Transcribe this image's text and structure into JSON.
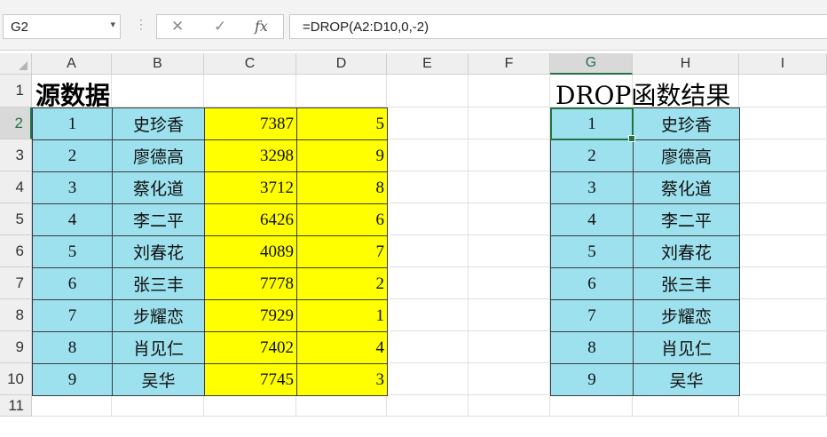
{
  "formula_bar": {
    "name_box": "G2",
    "formula": "=DROP(A2:D10,0,-2)",
    "cancel_icon": "✕",
    "enter_icon": "✓",
    "fx_label": "fx"
  },
  "columns": [
    "A",
    "B",
    "C",
    "D",
    "E",
    "F",
    "G",
    "H",
    "I"
  ],
  "rows": [
    "1",
    "2",
    "3",
    "4",
    "5",
    "6",
    "7",
    "8",
    "9",
    "10",
    "11"
  ],
  "selected_cell": "G2",
  "source_title": "源数据",
  "result_title": "DROP函数结果",
  "source_data": [
    [
      "1",
      "史珍香",
      "7387",
      "5"
    ],
    [
      "2",
      "廖德高",
      "3298",
      "9"
    ],
    [
      "3",
      "蔡化道",
      "3712",
      "8"
    ],
    [
      "4",
      "李二平",
      "6426",
      "6"
    ],
    [
      "5",
      "刘春花",
      "4089",
      "7"
    ],
    [
      "6",
      "张三丰",
      "7778",
      "2"
    ],
    [
      "7",
      "步耀恋",
      "7929",
      "1"
    ],
    [
      "8",
      "肖见仁",
      "7402",
      "4"
    ],
    [
      "9",
      "吴华",
      "7745",
      "3"
    ]
  ],
  "result_data": [
    [
      "1",
      "史珍香"
    ],
    [
      "2",
      "廖德高"
    ],
    [
      "3",
      "蔡化道"
    ],
    [
      "4",
      "李二平"
    ],
    [
      "5",
      "刘春花"
    ],
    [
      "6",
      "张三丰"
    ],
    [
      "7",
      "步耀恋"
    ],
    [
      "8",
      "肖见仁"
    ],
    [
      "9",
      "吴华"
    ]
  ],
  "colors": {
    "cyan_fill": "#9de1ee",
    "yellow_fill": "#ffff00",
    "selection": "#217346"
  }
}
